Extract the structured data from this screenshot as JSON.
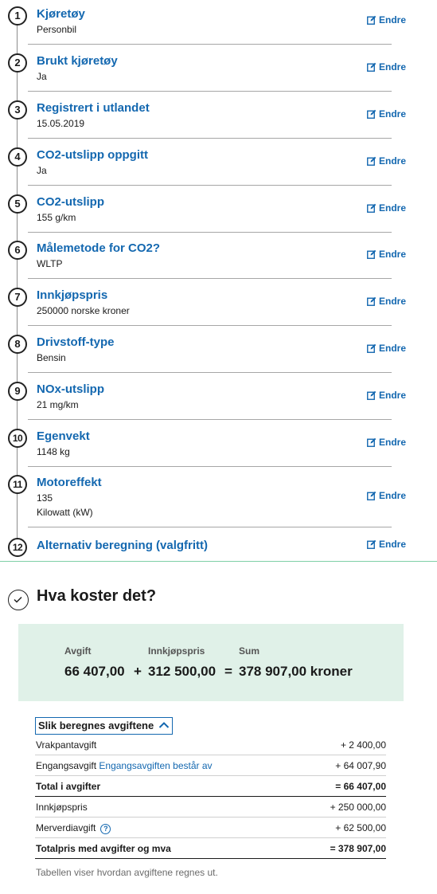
{
  "steps": [
    {
      "number": "1",
      "title": "Kjøretøy",
      "values": [
        "Personbil"
      ],
      "edit": "Endre"
    },
    {
      "number": "2",
      "title": "Brukt kjøretøy",
      "values": [
        "Ja"
      ],
      "edit": "Endre"
    },
    {
      "number": "3",
      "title": "Registrert i utlandet",
      "values": [
        "15.05.2019"
      ],
      "edit": "Endre"
    },
    {
      "number": "4",
      "title": "CO2-utslipp oppgitt",
      "values": [
        "Ja"
      ],
      "edit": "Endre"
    },
    {
      "number": "5",
      "title": "CO2-utslipp",
      "values": [
        "155 g/km"
      ],
      "edit": "Endre"
    },
    {
      "number": "6",
      "title": "Målemetode for CO2?",
      "values": [
        "WLTP"
      ],
      "edit": "Endre"
    },
    {
      "number": "7",
      "title": "Innkjøpspris",
      "values": [
        "250000 norske kroner"
      ],
      "edit": "Endre"
    },
    {
      "number": "8",
      "title": "Drivstoff-type",
      "values": [
        "Bensin"
      ],
      "edit": "Endre"
    },
    {
      "number": "9",
      "title": "NOx-utslipp",
      "values": [
        "21 mg/km"
      ],
      "edit": "Endre"
    },
    {
      "number": "10",
      "title": "Egenvekt",
      "values": [
        "1148 kg"
      ],
      "edit": "Endre"
    },
    {
      "number": "11",
      "title": "Motoreffekt",
      "values": [
        "135",
        "Kilowatt (kW)"
      ],
      "edit": "Endre"
    },
    {
      "number": "12",
      "title": "Alternativ beregning (valgfritt)",
      "values": [],
      "edit": "Endre"
    }
  ],
  "result": {
    "title": "Hva koster det?",
    "labels": {
      "fee": "Avgift",
      "price": "Innkjøpspris",
      "sum": "Sum"
    },
    "fee": "66 407,00",
    "plus": "+",
    "price": "312 500,00",
    "equals": "=",
    "sum": "378 907,00 kroner"
  },
  "calculation": {
    "toggle_label": "Slik beregnes avgiftene",
    "rows": [
      {
        "label": "Vrakpantavgift",
        "link": "",
        "value": "+ 2 400,00",
        "strong": false,
        "help": false
      },
      {
        "label": "Engangsavgift",
        "link": "Engangsavgiften består av",
        "value": "+ 64 007,90",
        "strong": false,
        "help": false
      },
      {
        "label": "Total i avgifter",
        "link": "",
        "value": "= 66 407,00",
        "strong": true,
        "help": false
      },
      {
        "label": "Innkjøpspris",
        "link": "",
        "value": "+ 250 000,00",
        "strong": false,
        "help": false
      },
      {
        "label": "Merverdiavgift",
        "link": "",
        "value": "+ 62 500,00",
        "strong": false,
        "help": true
      },
      {
        "label": "Totalpris med avgifter og mva",
        "link": "",
        "value": "= 378 907,00",
        "strong": true,
        "help": false
      }
    ],
    "note": "Tabellen viser hvordan avgiftene regnes ut."
  },
  "icons": {
    "edit": "edit-pencil-icon",
    "chevron": "chevron-up-icon",
    "check": "check-circle-icon",
    "help": "help-circle-icon"
  },
  "colors": {
    "link": "#1468b0",
    "summary_bg": "#e0f1e8",
    "divider_green": "#7fcfa6"
  }
}
